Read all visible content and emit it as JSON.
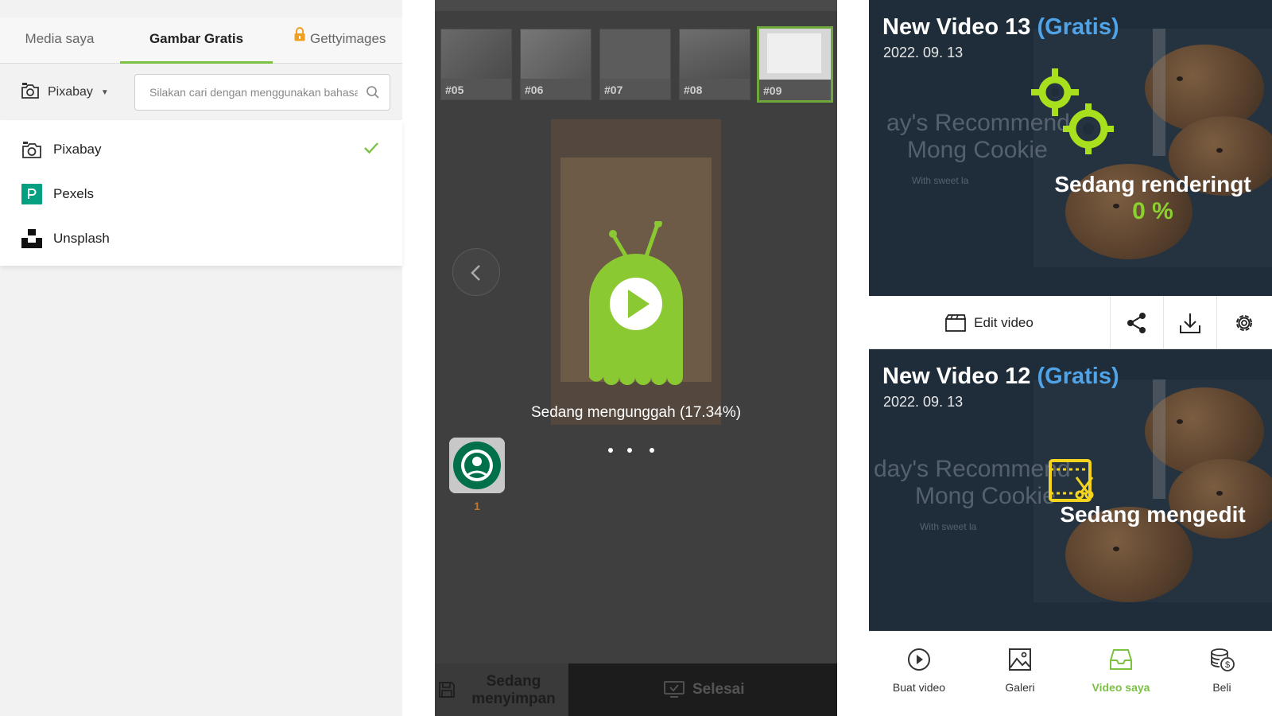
{
  "left": {
    "tabs": [
      {
        "label": "Media saya"
      },
      {
        "label": "Gambar Gratis",
        "active": true
      },
      {
        "label": "Gettyimages"
      }
    ],
    "source_select": {
      "label": "Pixabay"
    },
    "search": {
      "placeholder": "Silakan cari dengan menggunakan bahasa"
    },
    "sources": [
      {
        "label": "Pixabay",
        "selected": true
      },
      {
        "label": "Pexels"
      },
      {
        "label": "Unsplash"
      }
    ],
    "accent_color": "#7bc142"
  },
  "middle": {
    "thumbnails": [
      {
        "label": "#05"
      },
      {
        "label": "#06"
      },
      {
        "label": "#07"
      },
      {
        "label": "#08"
      },
      {
        "label": "#09",
        "selected": true
      }
    ],
    "upload_status": "Sedang mengunggah (17.34%)",
    "upload_progress_percent": 17.34,
    "media_count": "1",
    "save_button": "Sedang menyimpan",
    "done_button": "Selesai"
  },
  "right": {
    "videos": [
      {
        "title": "New Video 13",
        "tag": "(Gratis)",
        "date": "2022. 09. 13",
        "status": "Sedang renderingt",
        "percent": "0 %",
        "bg_line1": "ay's Recommend",
        "bg_line2": "Mong Cookie",
        "bg_line3": "With sweet la"
      },
      {
        "title": "New Video 12",
        "tag": "(Gratis)",
        "date": "2022. 09. 13",
        "status": "Sedang mengedit",
        "bg_line1": "day's Recommend",
        "bg_line2": "Mong Cookie",
        "bg_line3": "With sweet la"
      }
    ],
    "edit_button": "Edit video",
    "bottom_nav": [
      {
        "label": "Buat video",
        "icon": "play-circle-icon"
      },
      {
        "label": "Galeri",
        "icon": "image-icon"
      },
      {
        "label": "Video saya",
        "icon": "inbox-icon",
        "active": true
      },
      {
        "label": "Beli",
        "icon": "coins-icon"
      }
    ],
    "gratis_color": "#4fa3e6",
    "percent_color": "#8bd12e"
  }
}
